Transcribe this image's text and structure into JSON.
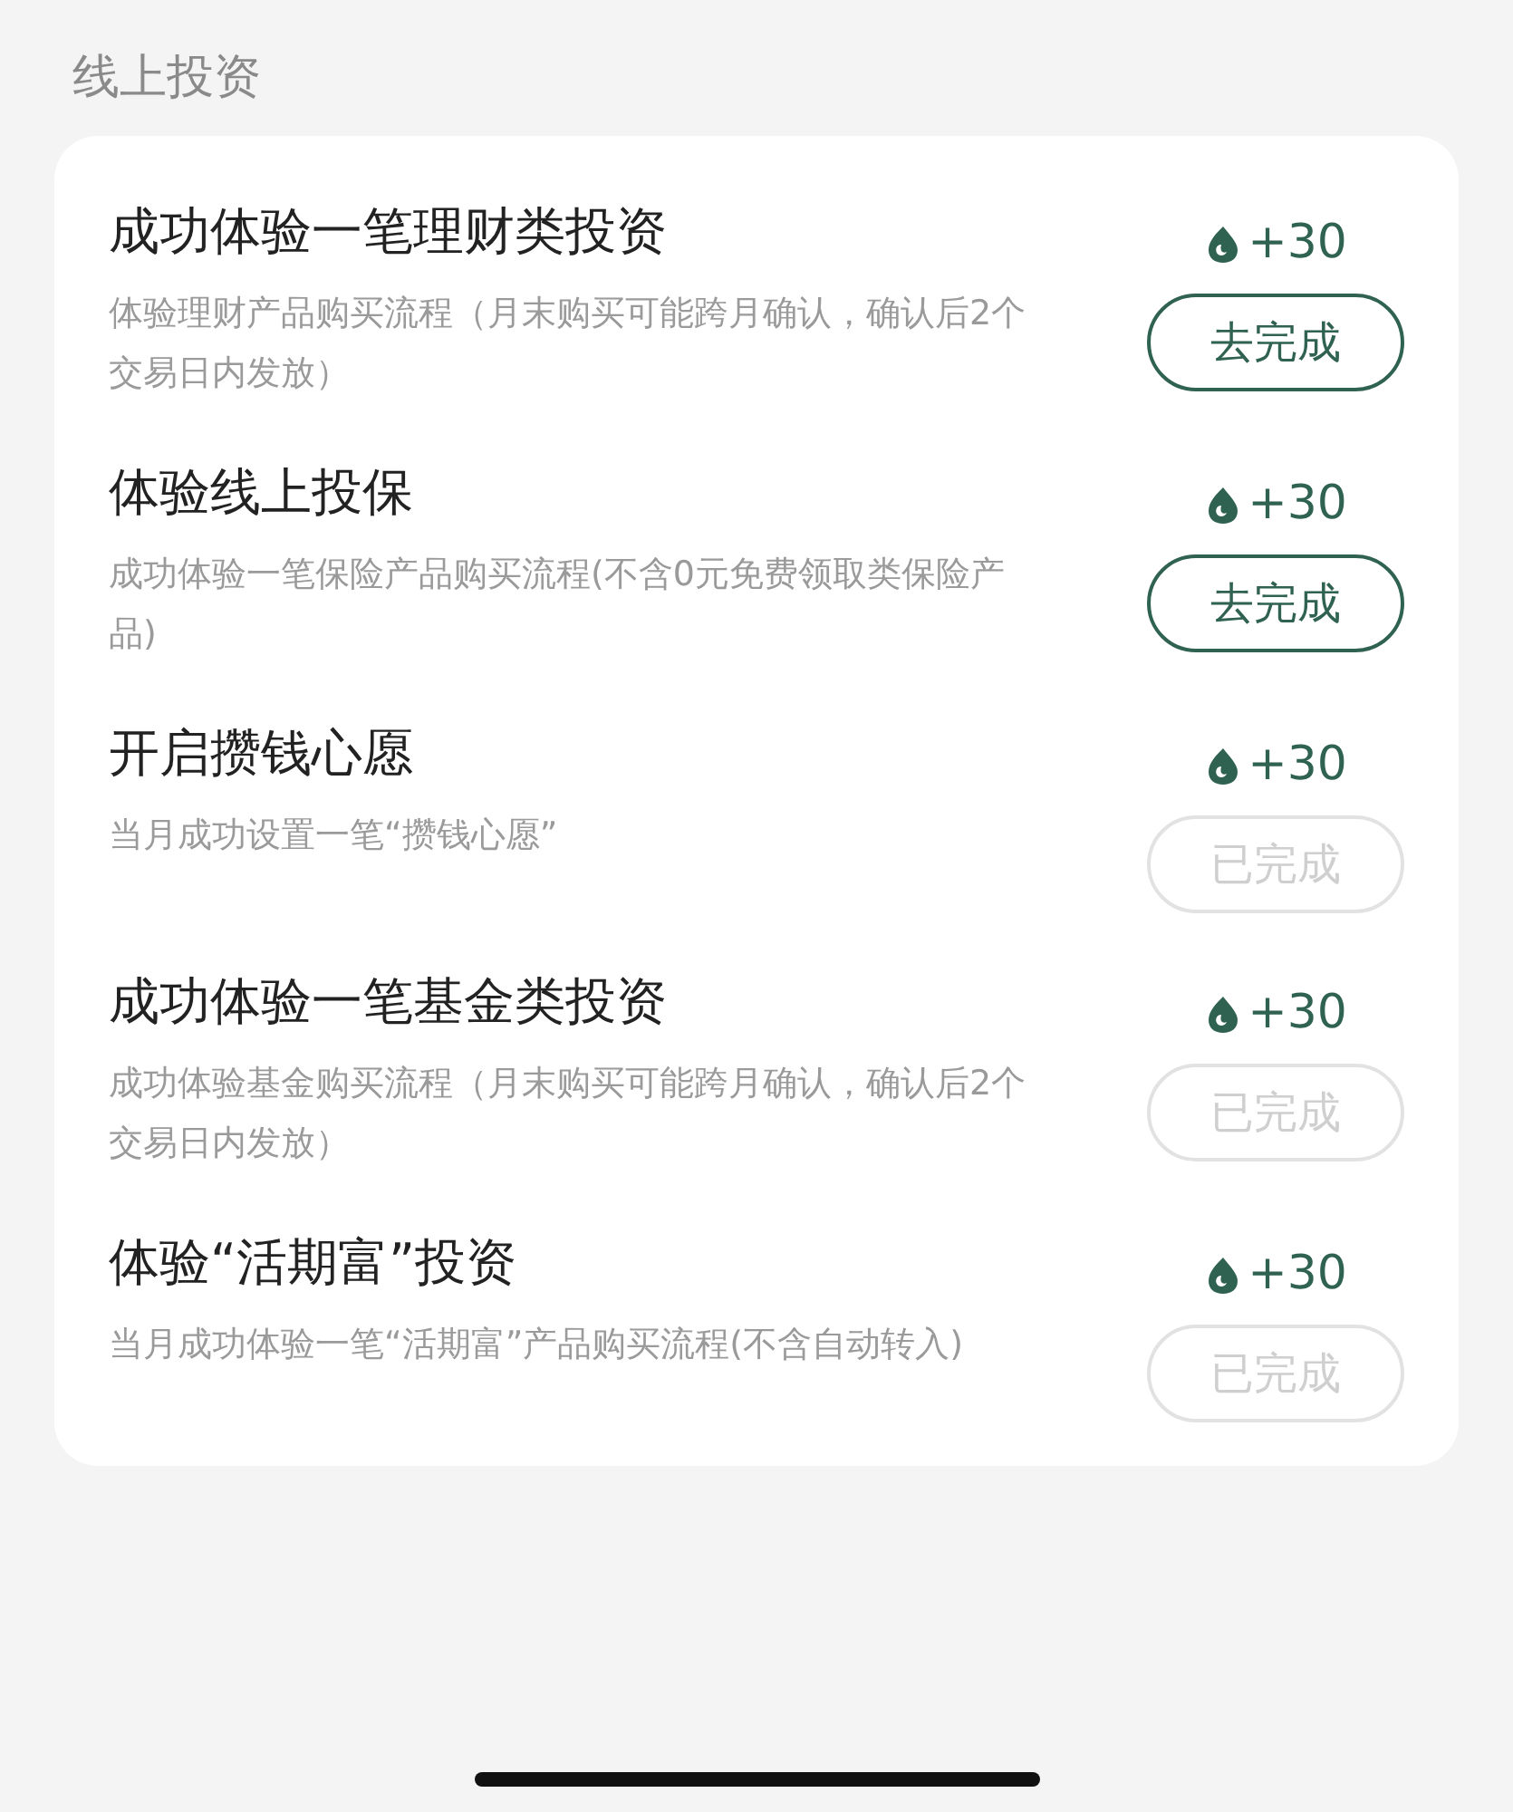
{
  "section_title": "线上投资",
  "tasks": [
    {
      "title": "成功体验一笔理财类投资",
      "description": "体验理财产品购买流程（月末购买可能跨月确认，确认后2个交易日内发放）",
      "reward": "+30",
      "button": "去完成",
      "completed": false
    },
    {
      "title": "体验线上投保",
      "description": "成功体验一笔保险产品购买流程(不含0元免费领取类保险产品)",
      "reward": "+30",
      "button": "去完成",
      "completed": false
    },
    {
      "title": "开启攒钱心愿",
      "description": "当月成功设置一笔“攒钱心愿”",
      "reward": "+30",
      "button": "已完成",
      "completed": true
    },
    {
      "title": "成功体验一笔基金类投资",
      "description": "成功体验基金购买流程（月末购买可能跨月确认，确认后2个交易日内发放）",
      "reward": "+30",
      "button": "已完成",
      "completed": true
    },
    {
      "title": "体验“活期富”投资",
      "description": "当月成功体验一笔“活期富”产品购买流程(不含自动转入)",
      "reward": "+30",
      "button": "已完成",
      "completed": true
    }
  ]
}
